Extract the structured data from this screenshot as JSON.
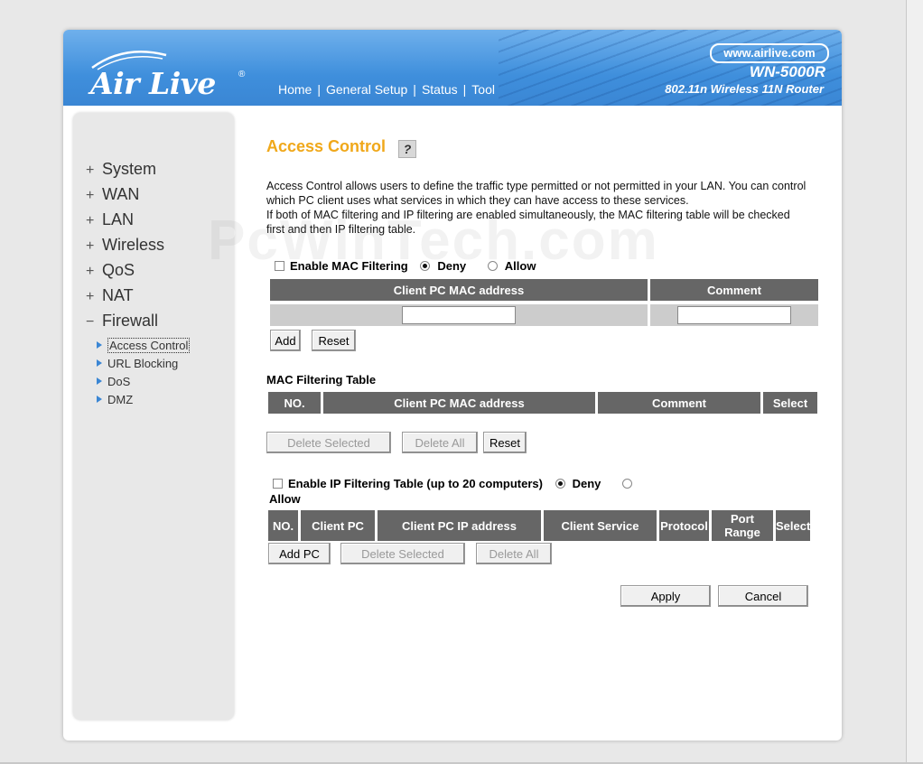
{
  "header": {
    "logo_text": "Air Live",
    "logo_mark": "®",
    "nav": [
      "Home",
      "General Setup",
      "Status",
      "Tool"
    ],
    "url": "www.airlive.com",
    "model": "WN-5000R",
    "model_desc": "802.11n Wireless 11N Router"
  },
  "sidebar": {
    "items": [
      {
        "sign": "+",
        "label": "System"
      },
      {
        "sign": "+",
        "label": "WAN"
      },
      {
        "sign": "+",
        "label": "LAN"
      },
      {
        "sign": "+",
        "label": "Wireless"
      },
      {
        "sign": "+",
        "label": "QoS"
      },
      {
        "sign": "+",
        "label": "NAT"
      },
      {
        "sign": "−",
        "label": "Firewall"
      }
    ],
    "subitems": [
      "Access Control",
      "URL Blocking",
      "DoS",
      "DMZ"
    ]
  },
  "page": {
    "title": "Access Control",
    "help_icon": "help-icon",
    "desc1": "Access Control allows users to define the traffic type permitted or not permitted in your LAN. You can control which PC client uses what services in which they can have access to these services.",
    "desc2": "If both of MAC filtering and IP filtering are enabled simultaneously, the MAC filtering table will be checked first and then IP filtering table.",
    "watermark": "PcWinTech.com"
  },
  "mac_filter": {
    "enable_label": "Enable MAC Filtering",
    "deny_label": "Deny",
    "allow_label": "Allow",
    "col_mac": "Client PC MAC address",
    "col_comment": "Comment",
    "mac_value": "",
    "comment_value": "",
    "add_label": "Add",
    "reset_label": "Reset"
  },
  "mac_table": {
    "title": "MAC Filtering Table",
    "headers": [
      "NO.",
      "Client PC MAC address",
      "Comment",
      "Select"
    ],
    "delete_selected": "Delete Selected",
    "delete_all": "Delete All",
    "reset": "Reset"
  },
  "ip_filter": {
    "enable_label": "Enable IP Filtering Table (up to 20 computers)",
    "deny_label": "Deny",
    "allow_label": "Allow",
    "headers": [
      "NO.",
      "Client PC",
      "Client PC IP address",
      "Client Service",
      "Protocol",
      "Port Range",
      "Select"
    ],
    "add_pc": "Add PC",
    "delete_selected": "Delete Selected",
    "delete_all": "Delete All"
  },
  "actions": {
    "apply": "Apply",
    "cancel": "Cancel"
  },
  "colors": {
    "title": "#f0a81a",
    "header_blue": "#3f8fdc",
    "table_header": "#666666"
  }
}
